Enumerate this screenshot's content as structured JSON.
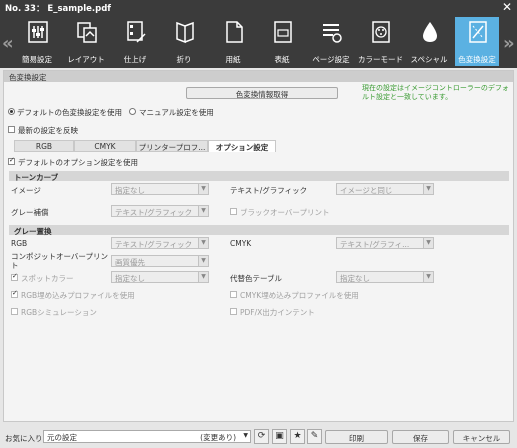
{
  "window": {
    "title": "No. 33： E_sample.pdf",
    "close": "✕"
  },
  "nav": {
    "prev": "«",
    "next": "»"
  },
  "toolbar": [
    {
      "label": "簡易設定",
      "icon": "basic-settings-icon"
    },
    {
      "label": "レイアウト",
      "icon": "layout-icon"
    },
    {
      "label": "仕上げ",
      "icon": "finishing-icon"
    },
    {
      "label": "折り",
      "icon": "fold-icon"
    },
    {
      "label": "用紙",
      "icon": "paper-icon"
    },
    {
      "label": "表紙",
      "icon": "cover-icon"
    },
    {
      "label": "ページ設定",
      "icon": "page-settings-icon"
    },
    {
      "label": "カラーモード",
      "icon": "color-mode-icon"
    },
    {
      "label": "スペシャル",
      "icon": "special-icon"
    },
    {
      "label": "色変換設定",
      "icon": "color-conversion-icon",
      "selected": true
    }
  ],
  "panel": {
    "header": "色変換設定",
    "get_info_button": "色変換情報取得",
    "note": "現在の設定はイメージコントローラーのデフォルト設定と一致しています。",
    "radio_default": "デフォルトの色変換設定を使用",
    "radio_manual": "マニュアル設定を使用",
    "reflect_latest": "最新の設定を反映",
    "tabs": [
      "RGB",
      "CMYK",
      "プリンタープロフ...",
      "オプション設定"
    ],
    "use_default_options": "デフォルトのオプション設定を使用",
    "tone_curve": {
      "section": "トーンカーブ",
      "image_label": "イメージ",
      "image_value": "指定なし",
      "text_graphic_label": "テキスト/グラフィック",
      "text_graphic_value": "イメージと同じ",
      "gray_label": "グレー補償",
      "gray_value": "テキスト/グラフィック",
      "black_overprint": "ブラックオーバープリント"
    },
    "gray_replace": {
      "section": "グレー置換",
      "rgb_label": "RGB",
      "rgb_value": "テキスト/グラフィック",
      "cmyk_label": "CMYK",
      "cmyk_value": "テキスト/グラフィ..."
    },
    "composite_overprint_label": "コンポジットオーバープリント",
    "composite_overprint_value": "画質優先",
    "spot_color": "スポットカラー",
    "spot_color_value": "指定なし",
    "substitute_table_label": "代替色テーブル",
    "substitute_table_value": "指定なし",
    "rgb_embedded": "RGB埋め込みプロファイルを使用",
    "cmyk_embedded": "CMYK埋め込みプロファイルを使用",
    "rgb_simulation": "RGBシミュレーション",
    "pdfx_intent": "PDF/X出力インテント"
  },
  "bottom": {
    "favorites_label": "お気に入り",
    "favorites_value": "元の設定",
    "favorites_state": "(変更あり)",
    "print": "印刷",
    "save": "保存",
    "cancel": "キャンセル"
  }
}
